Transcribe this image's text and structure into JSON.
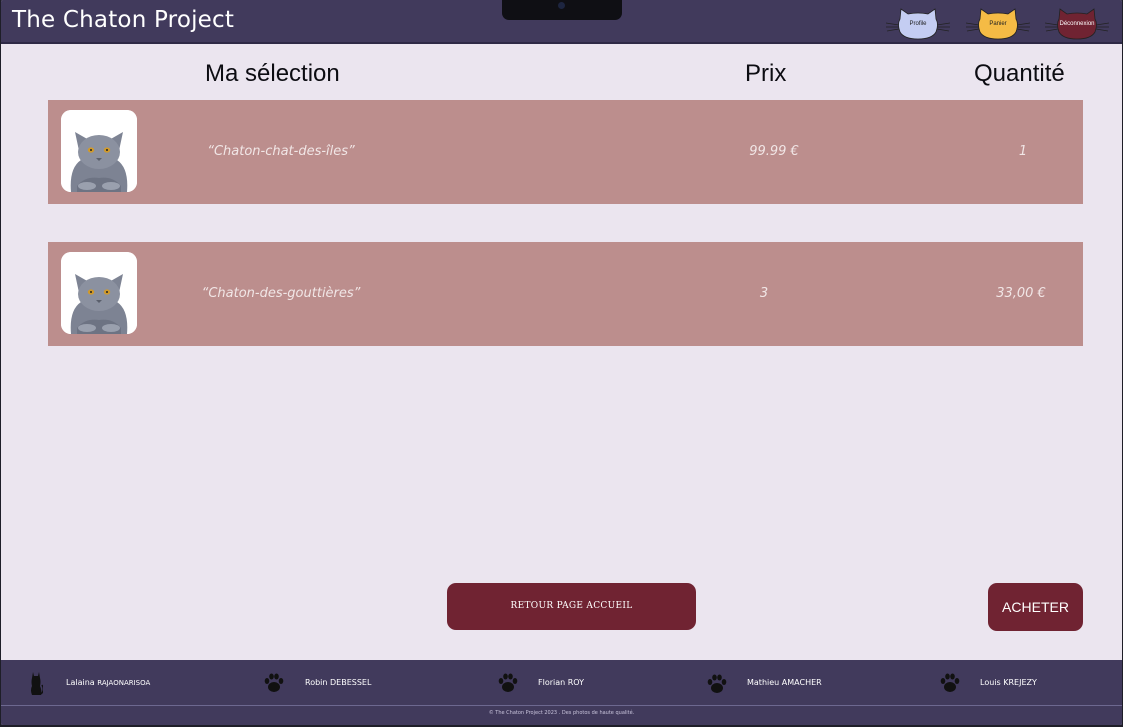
{
  "header": {
    "title": "The Chaton Project",
    "nav": [
      {
        "label": "Profile",
        "color": "#c4cdf2"
      },
      {
        "label": "Panier",
        "color": "#f5bb45"
      },
      {
        "label": "Déconnexion",
        "color": "#702332"
      }
    ]
  },
  "table": {
    "headers": {
      "selection": "Ma sélection",
      "price": "Prix",
      "quantity": "Quantité"
    },
    "rows": [
      {
        "name": "“Chaton-chat-des-îles”",
        "col2": "99.99 €",
        "col3": "1",
        "image": "grey-kitten-photo"
      },
      {
        "name": "“Chaton-des-gouttières”",
        "col2": "3",
        "col3": "33,00 €",
        "image": "grey-kitten-photo"
      }
    ]
  },
  "actions": {
    "back": "RETOUR PAGE ACCUEIL",
    "buy": "ACHETER"
  },
  "footer": {
    "members": [
      {
        "first": "Lalaina",
        "last": "RAJAONARISOA",
        "icon": "black-cat-icon"
      },
      {
        "first": "Robin",
        "last": "DEBESSEL",
        "icon": "paw-icon"
      },
      {
        "first": "Florian",
        "last": "ROY",
        "icon": "paw-icon"
      },
      {
        "first": "Mathieu",
        "last": "AMACHER",
        "icon": "paw-icon"
      },
      {
        "first": "Louis",
        "last": "KREJEZY",
        "icon": "paw-icon"
      }
    ],
    "copyright": "© The Chaton Project 2023 . Des  photos de haute qualité."
  },
  "colors": {
    "header_bg": "#413a5c",
    "page_bg": "#ebe5ef",
    "row_bg": "#bc8e8d",
    "button_bg": "#702332"
  }
}
